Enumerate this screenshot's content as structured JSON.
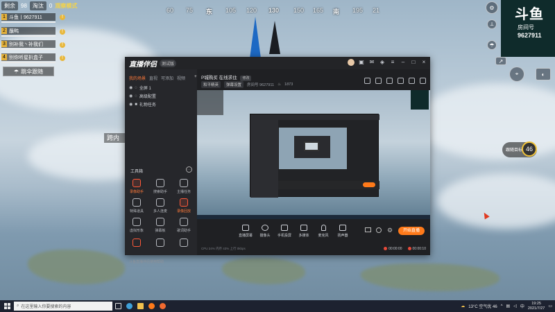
{
  "hud": {
    "alive_label": "剩余",
    "alive_count": "98",
    "eliminated_label": "淘汰",
    "eliminated_count": "0",
    "status": "观察模式"
  },
  "compass": {
    "marks": [
      "60",
      "75",
      "东",
      "105",
      "120",
      "150",
      "165",
      "南",
      "195",
      "21"
    ],
    "center_reading": "130"
  },
  "team": [
    {
      "num": "1",
      "name": "斗鱼丨9627911"
    },
    {
      "num": "2",
      "name": "蘸鸭"
    },
    {
      "num": "3",
      "name": "别补我丶补我们"
    },
    {
      "num": "4",
      "name": "别你听星扒盒子"
    }
  ],
  "jump_button": "跳伞跟随",
  "side_text": "跨内",
  "room_panel": {
    "logo": "斗鱼",
    "label": "房间号",
    "number": "9627911"
  },
  "right_badge": {
    "label": "跟随目标",
    "value": "46"
  },
  "app": {
    "brand": "直播伴侣",
    "beta": "测试版",
    "sidebar_tabs": [
      "我的场景",
      "直视",
      "可添加",
      "视频"
    ],
    "scenes": [
      "全屏 1",
      "高级配置",
      "礼物任务"
    ],
    "tools_title": "工具箱",
    "tools": [
      {
        "label": "录像助手",
        "hot": true
      },
      {
        "label": "搜索助手",
        "hot": false
      },
      {
        "label": "主播任务",
        "hot": false
      },
      {
        "label": "特殊道具",
        "hot": false
      },
      {
        "label": "多人连麦",
        "hot": false
      },
      {
        "label": "录像回放",
        "hot": true
      },
      {
        "label": "虚拟形象",
        "hot": false
      },
      {
        "label": "弹幕板",
        "hot": false
      },
      {
        "label": "歌词助手",
        "hot": false
      }
    ],
    "notice": "斗鱼直播伴侣使用帮助",
    "room_title": "P城购买 在线求住",
    "edit_tag": "修改",
    "meta_chip_1": "和平精英",
    "meta_chip_2": "弹幕设置",
    "meta_room": "房间号 9627911",
    "meta_hot": "1873",
    "bottom_buttons": [
      "直播屏幕",
      "摄像头",
      "手机投屏",
      "多媒体",
      "麦克风",
      "扬声器"
    ],
    "go_live": "开始直播",
    "stats": "CPU 24%  内存 43%  上行 0kbps",
    "timer_live": "00:00:00",
    "timer_rec": "00:00:10"
  },
  "taskbar": {
    "search_placeholder": "在这里输入你要搜索的内容",
    "weather": "13°C 空气优 46",
    "time": "19:25",
    "date": "2021/7/27"
  }
}
